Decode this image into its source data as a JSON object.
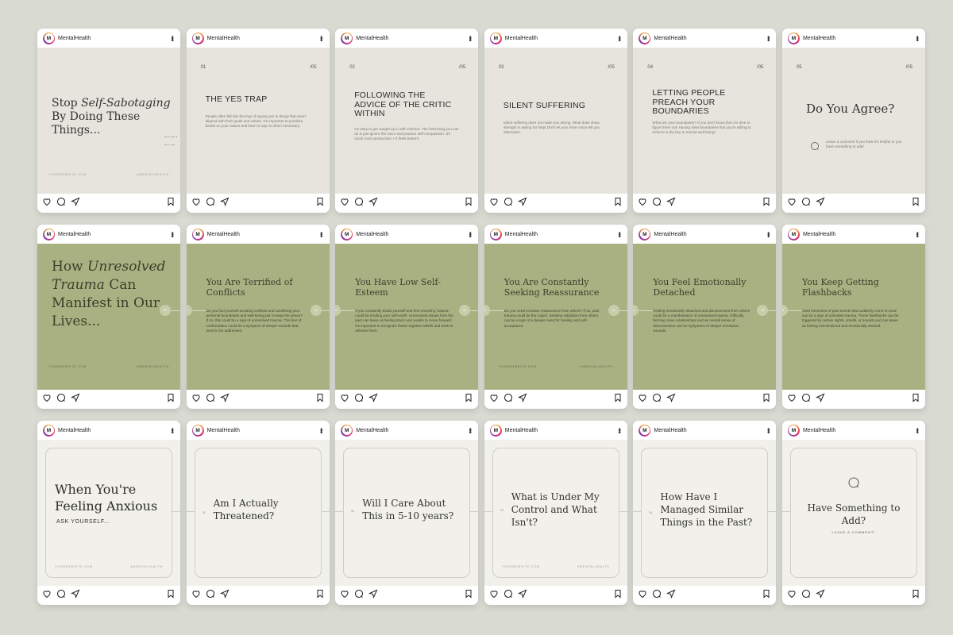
{
  "account": {
    "handle": "MentalHealth",
    "avatar_letter": "M"
  },
  "row1": {
    "cards": [
      {
        "title_parts": [
          "Stop ",
          "Self-Sabotaging",
          " By Doing These Things..."
        ],
        "dots": "..... ....",
        "footer_left": "YOURWEBSITE.COM",
        "footer_right": "#MENTALHEALTH"
      },
      {
        "num": "01",
        "total": "/05",
        "title": "THE YES TRAP",
        "body": "People often fall into the trap of saying yes to things that aren't aligned with their goals and values. It's important to prioritize based on your values and learn to say no when necessary."
      },
      {
        "num": "02",
        "total": "/05",
        "title": "FOLLOWING THE ADVICE OF THE CRITIC WITHIN",
        "body": "It's easy to get caught up in self-criticism. The best thing you can do is just ignore the voice and practice self-compassion. It's much more productive! + it feels better!)"
      },
      {
        "num": "03",
        "total": "/05",
        "title": "SILENT SUFFERING",
        "body": "Silent suffering does not make you strong. What does show strength is asking for help! Don't let your inner voice tell you otherwise!"
      },
      {
        "num": "04",
        "total": "/05",
        "title": "LETTING PEOPLE PREACH YOUR BOUNDARIES",
        "body": "What are your boundaries? If you don't know then it's time to figure them out! Having clear boundaries that you're willing to enforce is the key to mental well-being!"
      },
      {
        "num": "05",
        "total": "/05",
        "title": "Do You Agree?",
        "body": "Leave a comment if you think it's helpful or you have something to add!"
      }
    ]
  },
  "row2": {
    "cards": [
      {
        "title_parts": [
          "How ",
          "Unresolved Trauma",
          " Can Manifest in Our Lives..."
        ],
        "circle": "01",
        "footer_left": "YOURWEBSITE.COM",
        "footer_right": "#MENTALHEALTH"
      },
      {
        "title": "You Are Terrified of Conflicts",
        "circle_left": "01",
        "circle_right": "02",
        "body": "Do you find yourself avoiding conflicts and sacrificing your personal boundaries and well-being just to keep the peace? If so, this could be a sign of unresolved trauma. The fear of confrontation could be a symptom of deeper wounds that need to be addressed."
      },
      {
        "title": "You Have Low Self-Esteem",
        "circle_left": "02",
        "circle_right": "03",
        "body": "If you constantly doubt yourself and feel unworthy, trauma could be eroding your self-worth. Unresolved issues from the past can leave us feeling stuck and unable to move forward. It's important to recognize these negative beliefs and work to reframe them."
      },
      {
        "title": "You Are Constantly Seeking Reassurance",
        "circle_left": "03",
        "circle_right": "04",
        "body": "Do you need constant reassurance from others? If so, past trauma could be the culprit. Seeking validation from others can be a sign of a deeper need for healing and self-acceptance.",
        "footer_left": "YOURWEBSITE.COM",
        "footer_right": "#MENTALHEALTH"
      },
      {
        "title": "You Feel Emotionally Detached",
        "circle_left": "04",
        "circle_right": "05",
        "body": "Feeling emotionally detached and disconnected from others could be a manifestation of unresolved trauma. Difficulty forming close relationships and an overall sense of disconnection can be symptoms of deeper emotional wounds."
      },
      {
        "title": "You Keep Getting Flashbacks",
        "circle_left": "05",
        "body": "Vivid memories of past events that suddenly come to mind can be a sign of unhealed trauma. These flashbacks can be triggered by certain sights, smells, or sounds and can leave us feeling overwhelmed and emotionally drained."
      }
    ]
  },
  "row3": {
    "cards": [
      {
        "title": "When You're Feeling Anxious",
        "sub": "ASK YOURSELF...",
        "footer_left": "YOURWEBSITE.COM",
        "footer_right": "#MENTALHEALTH"
      },
      {
        "num": "01",
        "title": "Am I Actually Threatened?"
      },
      {
        "num": "02",
        "title": "Will I Care About This in 5-10 years?"
      },
      {
        "num": "03",
        "title": "What is Under My Control and What Isn't?",
        "footer_left": "YOURWEBSITE.COM",
        "footer_right": "#MENTALHEALTH"
      },
      {
        "num": "04",
        "title": "How Have I Managed Similar Things in the Past?"
      },
      {
        "title": "Have Something to Add?",
        "sub": "LEAVE A COMMENT!"
      }
    ]
  },
  "colors": {
    "background": "#d9dbd3",
    "beige": "#e6e4dc",
    "sage": "#a9b182",
    "cream": "#f1f0ea"
  }
}
